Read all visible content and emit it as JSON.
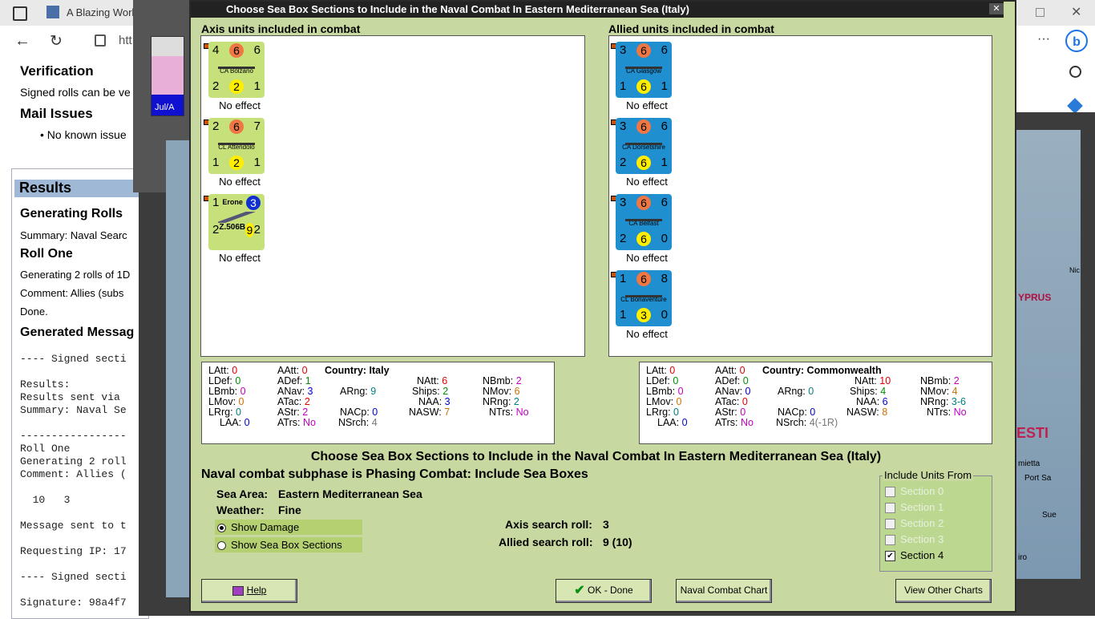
{
  "browser": {
    "tab_title": "A Blazing World",
    "address": "htt",
    "verification_title": "Verification",
    "verification_text": "Signed rolls can be ve",
    "mail_title": "Mail Issues",
    "mail_item": "No known issue",
    "results_title": "Results",
    "generating_title": "Generating Rolls",
    "summary": "Summary: Naval Searc",
    "roll_one": "Roll One",
    "generating_text": "Generating 2 rolls of 1D",
    "comment": "Comment: Allies (subs",
    "done": "Done.",
    "gen_msg": "Generated Messag",
    "mono": [
      "---- Signed secti",
      "",
      "Results:",
      "Results sent via",
      "Summary: Naval Se",
      "",
      "-----------------",
      "Roll One",
      "Generating 2 roll",
      "Comment: Allies (",
      "",
      "  10   3",
      "",
      "Message sent to t",
      "",
      "Requesting IP: 17",
      "",
      "---- Signed secti",
      "",
      "Signature: 98a4f7"
    ]
  },
  "game": {
    "date_label": "Jul/A",
    "map_label_cyprus": "YPRUS",
    "map_label_esti": "ESTI",
    "map_labels_right": [
      "mietta",
      "Port Sa",
      "Sue",
      "iro",
      "Nic"
    ]
  },
  "dialog": {
    "title": "Choose Sea Box Sections to Include in the Naval Combat In Eastern Mediterranean Sea (Italy)",
    "axis_header": "Axis units included in combat",
    "allied_header": "Allied units included in combat",
    "axis_units": [
      {
        "name": "CA Bolzano",
        "tl": "4",
        "tc": "6",
        "tr": "6",
        "bl": "2",
        "bc": "2",
        "br": "1",
        "result": "No effect"
      },
      {
        "name": "CL Attendolo",
        "tl": "2",
        "tc": "6",
        "tr": "7",
        "bl": "1",
        "bc": "2",
        "br": "1",
        "result": "No effect"
      },
      {
        "name": "Erone",
        "tl": "1",
        "tc": "3",
        "tr": "",
        "bl": "2",
        "bc": "9",
        "br": "2",
        "sub": "Z.506B",
        "result": "No effect"
      }
    ],
    "allied_units": [
      {
        "name": "CA Glasgow",
        "tl": "3",
        "tc": "6",
        "tr": "6",
        "bl": "1",
        "bc": "6",
        "br": "1",
        "result": "No effect"
      },
      {
        "name": "CA Dorsetshire",
        "tl": "3",
        "tc": "6",
        "tr": "6",
        "bl": "2",
        "bc": "6",
        "br": "1",
        "result": "No effect"
      },
      {
        "name": "CA Belfast",
        "tl": "3",
        "tc": "6",
        "tr": "6",
        "bl": "2",
        "bc": "6",
        "br": "0",
        "result": "No effect"
      },
      {
        "name": "CL Bonaventure",
        "tl": "1",
        "tc": "6",
        "tr": "8",
        "bl": "1",
        "bc": "3",
        "br": "0",
        "result": "No effect"
      }
    ],
    "axis_stats": {
      "latt": "LAtt:",
      "latt_v": "0",
      "aatt": "AAtt:",
      "aatt_v": "0",
      "country": "Country: Italy",
      "ldef": "LDef:",
      "ldef_v": "0",
      "adef": "ADef:",
      "adef_v": "1",
      "natt": "NAtt:",
      "natt_v": "6",
      "nbmb": "NBmb:",
      "nbmb_v": "2",
      "lbmb": "LBmb:",
      "lbmb_v": "0",
      "anav": "ANav:",
      "anav_v": "3",
      "arng": "ARng:",
      "arng_v": "9",
      "ships": "Ships:",
      "ships_v": "2",
      "nmov": "NMov:",
      "nmov_v": "6",
      "lmov": "LMov:",
      "lmov_v": "0",
      "atac": "ATac:",
      "atac_v": "2",
      "naa": "NAA:",
      "naa_v": "3",
      "nrng": "NRng:",
      "nrng_v": "2",
      "lrrg": "LRrg:",
      "lrrg_v": "0",
      "astr": "AStr:",
      "astr_v": "2",
      "nacp": "NACp:",
      "nacp_v": "0",
      "nasw": "NASW:",
      "nasw_v": "7",
      "ntrs": "NTrs:",
      "ntrs_v": "No",
      "laa": "LAA:",
      "laa_v": "0",
      "atrs": "ATrs:",
      "atrs_v": "No",
      "nsrch": "NSrch:",
      "nsrch_v": "4"
    },
    "allied_stats": {
      "latt": "LAtt:",
      "latt_v": "0",
      "aatt": "AAtt:",
      "aatt_v": "0",
      "country": "Country: Commonwealth",
      "ldef": "LDef:",
      "ldef_v": "0",
      "adef": "ADef:",
      "adef_v": "0",
      "natt": "NAtt:",
      "natt_v": "10",
      "nbmb": "NBmb:",
      "nbmb_v": "2",
      "lbmb": "LBmb:",
      "lbmb_v": "0",
      "anav": "ANav:",
      "anav_v": "0",
      "arng": "ARng:",
      "arng_v": "0",
      "ships": "Ships:",
      "ships_v": "4",
      "nmov": "NMov:",
      "nmov_v": "4",
      "lmov": "LMov:",
      "lmov_v": "0",
      "atac": "ATac:",
      "atac_v": "0",
      "naa": "NAA:",
      "naa_v": "6",
      "nrng": "NRng:",
      "nrng_v": "3-6",
      "lrrg": "LRrg:",
      "lrrg_v": "0",
      "astr": "AStr:",
      "astr_v": "0",
      "nacp": "NACp:",
      "nacp_v": "0",
      "nasw": "NASW:",
      "nasw_v": "8",
      "ntrs": "NTrs:",
      "ntrs_v": "No",
      "laa": "LAA:",
      "laa_v": "0",
      "atrs": "ATrs:",
      "atrs_v": "No",
      "nsrch": "NSrch:",
      "nsrch_v": "4(-1R)"
    },
    "center_title": "Choose Sea Box Sections to Include in the Naval Combat In Eastern Mediterranean Sea (Italy)",
    "subphase": "Naval combat subphase is Phasing Combat: Include Sea Boxes",
    "sea_area_label": "Sea Area:",
    "sea_area": "Eastern Mediterranean Sea",
    "weather_label": "Weather:",
    "weather": "Fine",
    "show_damage": "Show Damage",
    "show_sections": "Show Sea Box Sections",
    "axis_search": "Axis search roll:",
    "axis_search_v": "3",
    "allied_search": "Allied search roll:",
    "allied_search_v": "9 (10)",
    "include_title": "Include Units From",
    "sections": [
      {
        "label": "Section 0",
        "checked": false
      },
      {
        "label": "Section 1",
        "checked": false
      },
      {
        "label": "Section 2",
        "checked": false
      },
      {
        "label": "Section 3",
        "checked": false
      },
      {
        "label": "Section 4",
        "checked": true
      }
    ],
    "help": "Help",
    "ok": "OK - Done",
    "naval_chart": "Naval Combat Chart",
    "other_charts": "View Other Charts"
  },
  "colors": {
    "counter_green": "#c6e07a",
    "counter_blue": "#1f8fd0",
    "dialog_bg": "#c7d8a0",
    "stat_red": "#e00000",
    "stat_green": "#009000",
    "stat_blue": "#0000d0",
    "stat_magenta": "#c000c0",
    "stat_orange": "#d07000",
    "stat_teal": "#008080"
  }
}
